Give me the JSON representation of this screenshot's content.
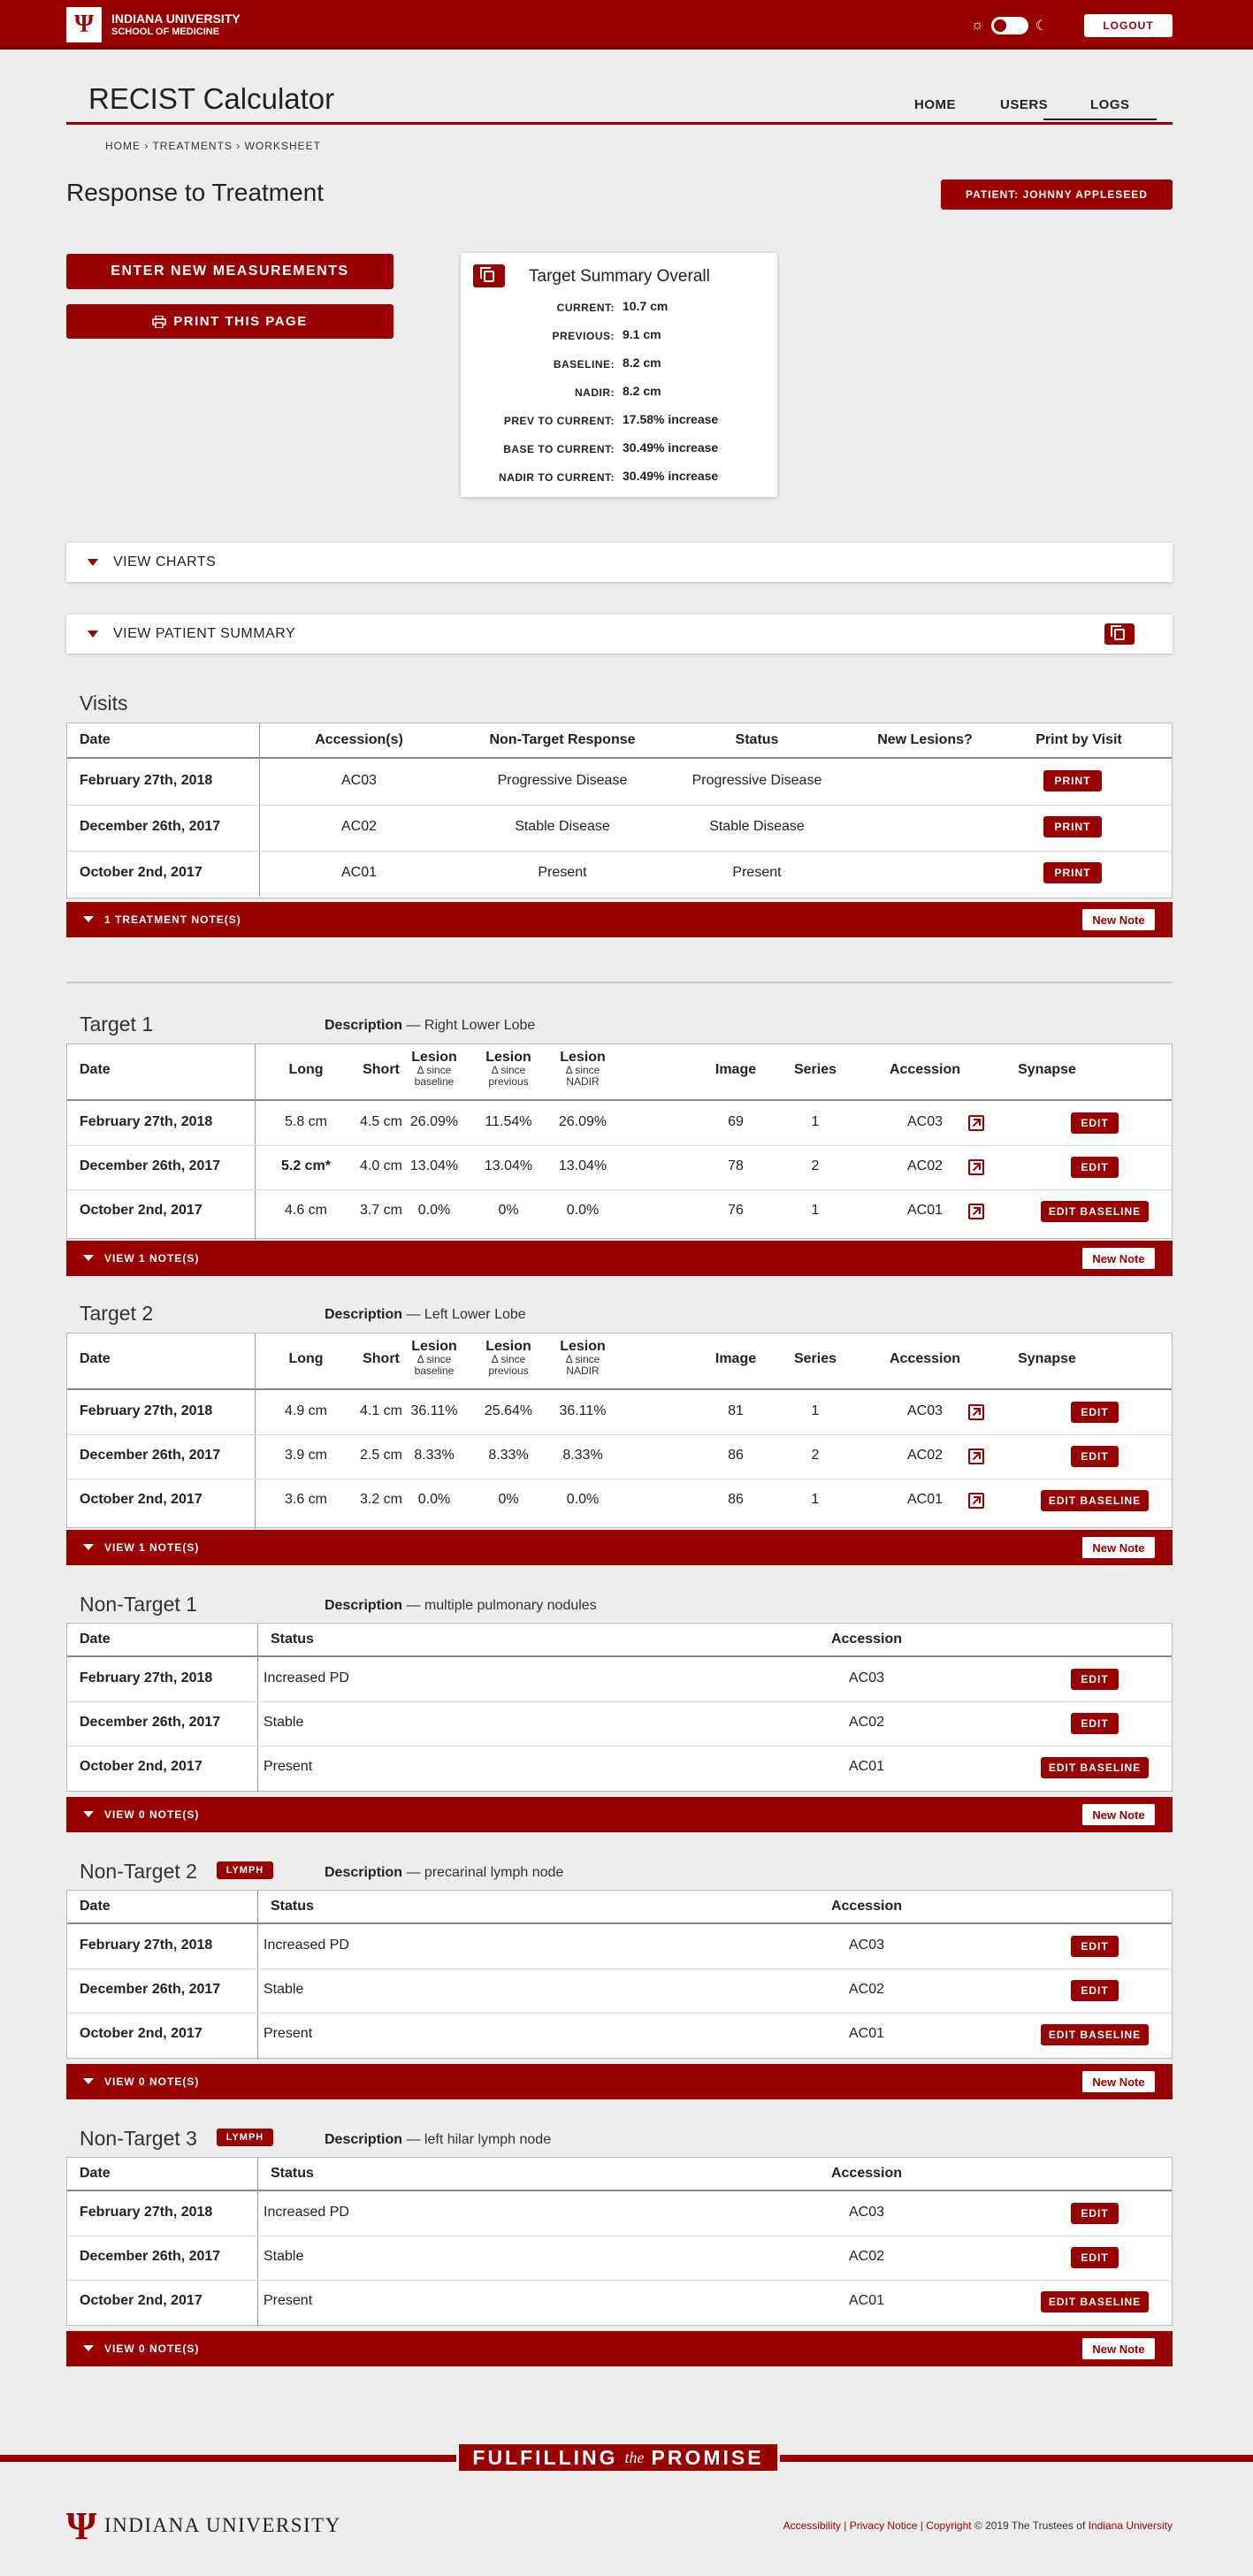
{
  "header": {
    "logo_glyph": "Ψ",
    "brand_line1": "INDIANA UNIVERSITY",
    "brand_line2": "SCHOOL OF MEDICINE",
    "logout_label": "LOGOUT",
    "theme_toggle": {
      "sun_icon": "☼",
      "moon_icon": "☾"
    },
    "brand_color": "#990000"
  },
  "app": {
    "title": "RECIST Calculator",
    "nav": [
      "HOME",
      "USERS",
      "LOGS"
    ],
    "active_nav": "LOGS"
  },
  "breadcrumb": [
    "HOME",
    "TREATMENTS",
    "WORKSHEET"
  ],
  "page": {
    "title": "Response to Treatment",
    "patient_label": "PATIENT: JOHNNY APPLESEED",
    "enter_label": "ENTER NEW MEASUREMENTS",
    "print_label": "PRINT THIS PAGE"
  },
  "summary": {
    "title": "Target Summary Overall",
    "rows": [
      {
        "k": "CURRENT:",
        "v": "10.7 cm"
      },
      {
        "k": "PREVIOUS:",
        "v": "9.1 cm"
      },
      {
        "k": "BASELINE:",
        "v": "8.2 cm"
      },
      {
        "k": "NADIR:",
        "v": "8.2 cm"
      },
      {
        "k": "PREV TO CURRENT:",
        "v": "17.58% increase"
      },
      {
        "k": "BASE TO CURRENT:",
        "v": "30.49% increase"
      },
      {
        "k": "NADIR TO CURRENT:",
        "v": "30.49% increase"
      }
    ]
  },
  "accordions": {
    "charts": "VIEW CHARTS",
    "patient_summary": "VIEW PATIENT SUMMARY"
  },
  "visits": {
    "title": "Visits",
    "headers": [
      "Date",
      "Accession(s)",
      "Non-Target Response",
      "Status",
      "New Lesions?",
      "Print by Visit"
    ],
    "rows": [
      {
        "date": "February 27th, 2018",
        "acc": "AC03",
        "ntr": "Progressive Disease",
        "status": "Progressive Disease",
        "new": "",
        "btn": "PRINT"
      },
      {
        "date": "December 26th, 2017",
        "acc": "AC02",
        "ntr": "Stable Disease",
        "status": "Stable Disease",
        "new": "",
        "btn": "PRINT"
      },
      {
        "date": "October 2nd, 2017",
        "acc": "AC01",
        "ntr": "Present",
        "status": "Present",
        "new": "",
        "btn": "PRINT"
      }
    ],
    "notes_label": "1 TREATMENT NOTE(S)"
  },
  "new_note_label": "New Note",
  "target_headers": {
    "date": "Date",
    "long": "Long",
    "short": "Short",
    "lesion": "Lesion",
    "delta": "Δ",
    "since": "since",
    "baseline": "baseline",
    "previous": "previous",
    "nadir": "NADIR",
    "image": "Image",
    "series": "Series",
    "accession": "Accession",
    "synapse": "Synapse"
  },
  "targets": [
    {
      "title": "Target 1",
      "desc_label": "Description",
      "desc": "— Right Lower Lobe",
      "rows": [
        {
          "date": "February 27th, 2018",
          "long": "5.8 cm",
          "short": "4.5 cm",
          "b": "26.09%",
          "p": "11.54%",
          "n": "26.09%",
          "image": "69",
          "series": "1",
          "acc": "AC03",
          "btn": "EDIT"
        },
        {
          "date": "December 26th, 2017",
          "long": "5.2 cm*",
          "short": "4.0 cm",
          "b": "13.04%",
          "p": "13.04%",
          "n": "13.04%",
          "image": "78",
          "series": "2",
          "acc": "AC02",
          "btn": "EDIT"
        },
        {
          "date": "October 2nd, 2017",
          "long": "4.6 cm",
          "short": "3.7 cm",
          "b": "0.0%",
          "p": "0%",
          "n": "0.0%",
          "image": "76",
          "series": "1",
          "acc": "AC01",
          "btn": "EDIT BASELINE"
        }
      ],
      "notes_label": "VIEW 1 NOTE(S)"
    },
    {
      "title": "Target 2",
      "desc_label": "Description",
      "desc": "— Left Lower Lobe",
      "rows": [
        {
          "date": "February 27th, 2018",
          "long": "4.9 cm",
          "short": "4.1 cm",
          "b": "36.11%",
          "p": "25.64%",
          "n": "36.11%",
          "image": "81",
          "series": "1",
          "acc": "AC03",
          "btn": "EDIT"
        },
        {
          "date": "December 26th, 2017",
          "long": "3.9 cm",
          "short": "2.5 cm",
          "b": "8.33%",
          "p": "8.33%",
          "n": "8.33%",
          "image": "86",
          "series": "2",
          "acc": "AC02",
          "btn": "EDIT"
        },
        {
          "date": "October 2nd, 2017",
          "long": "3.6 cm",
          "short": "3.2 cm",
          "b": "0.0%",
          "p": "0%",
          "n": "0.0%",
          "image": "86",
          "series": "1",
          "acc": "AC01",
          "btn": "EDIT BASELINE"
        }
      ],
      "notes_label": "VIEW 1 NOTE(S)"
    }
  ],
  "nontarget_headers": {
    "date": "Date",
    "status": "Status",
    "accession": "Accession"
  },
  "nontargets": [
    {
      "title": "Non-Target 1",
      "badge": "",
      "desc_label": "Description",
      "desc": "— multiple pulmonary nodules",
      "rows": [
        {
          "date": "February 27th, 2018",
          "status": "Increased PD",
          "acc": "AC03",
          "btn": "EDIT"
        },
        {
          "date": "December 26th, 2017",
          "status": "Stable",
          "acc": "AC02",
          "btn": "EDIT"
        },
        {
          "date": "October 2nd, 2017",
          "status": "Present",
          "acc": "AC01",
          "btn": "EDIT BASELINE"
        }
      ],
      "notes_label": "VIEW 0 NOTE(S)"
    },
    {
      "title": "Non-Target 2",
      "badge": "LYMPH",
      "desc_label": "Description",
      "desc": "— precarinal lymph node",
      "rows": [
        {
          "date": "February 27th, 2018",
          "status": "Increased PD",
          "acc": "AC03",
          "btn": "EDIT"
        },
        {
          "date": "December 26th, 2017",
          "status": "Stable",
          "acc": "AC02",
          "btn": "EDIT"
        },
        {
          "date": "October 2nd, 2017",
          "status": "Present",
          "acc": "AC01",
          "btn": "EDIT BASELINE"
        }
      ],
      "notes_label": "VIEW 0 NOTE(S)"
    },
    {
      "title": "Non-Target 3",
      "badge": "LYMPH",
      "desc_label": "Description",
      "desc": "— left hilar lymph node",
      "rows": [
        {
          "date": "February 27th, 2018",
          "status": "Increased PD",
          "acc": "AC03",
          "btn": "EDIT"
        },
        {
          "date": "December 26th, 2017",
          "status": "Stable",
          "acc": "AC02",
          "btn": "EDIT"
        },
        {
          "date": "October 2nd, 2017",
          "status": "Present",
          "acc": "AC01",
          "btn": "EDIT BASELINE"
        }
      ],
      "notes_label": "VIEW 0 NOTE(S)"
    }
  ],
  "footer": {
    "banner_left": "FULFILLING",
    "banner_mid": "the",
    "banner_right": "PROMISE",
    "logo_glyph": "Ψ",
    "name": "INDIANA UNIVERSITY",
    "links": [
      {
        "text": "Accessibility",
        "link": true
      },
      {
        "text": " | ",
        "link": false
      },
      {
        "text": "Privacy Notice",
        "link": true
      },
      {
        "text": " | ",
        "link": false
      },
      {
        "text": "Copyright",
        "link": true
      },
      {
        "text": " © 2019 The Trustees of ",
        "link": false
      },
      {
        "text": "Indiana University",
        "link": true
      }
    ]
  }
}
